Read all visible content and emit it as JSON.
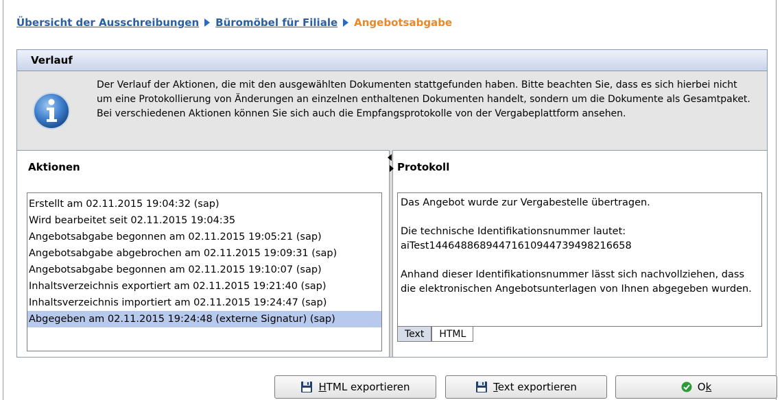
{
  "breadcrumb": {
    "items": [
      "Übersicht der Ausschreibungen",
      "Büromöbel für Filiale"
    ],
    "current": "Angebotsabgabe"
  },
  "panel": {
    "title": "Verlauf",
    "info_text": "Der Verlauf der Aktionen, die mit den ausgewählten Dokumenten stattgefunden haben. Bitte beachten Sie, dass es sich hierbei nicht um eine Protokollierung von Änderungen an einzelnen enthaltenen Dokumenten handelt, sondern um die Dokumente als Gesamtpaket. Bei verschiedenen Aktionen können Sie sich auch die Empfangsprotokolle von der Vergabeplattform ansehen."
  },
  "actions": {
    "title": "Aktionen",
    "items": [
      "Erstellt am 02.11.2015 19:04:32 (sap)",
      "Wird bearbeitet seit 02.11.2015 19:04:35",
      "Angebotsabgabe begonnen am 02.11.2015 19:05:21 (sap)",
      "Angebotsabgabe abgebrochen am 02.11.2015 19:09:31 (sap)",
      "Angebotsabgabe begonnen am 02.11.2015 19:10:07 (sap)",
      "Inhaltsverzeichnis exportiert am 02.11.2015 19:21:40 (sap)",
      "Inhaltsverzeichnis importiert am 02.11.2015 19:24:47 (sap)",
      "Abgegeben am 02.11.2015 19:24:48 (externe Signatur) (sap)"
    ],
    "selected_index": 7
  },
  "protocol": {
    "title": "Protokoll",
    "line1": "Das Angebot wurde zur Vergabestelle übertragen.",
    "line2": "Die technische Identifikationsnummer lautet:",
    "line3": "aiTest1446488689447161094473949821665 8",
    "line4": "Anhand dieser Identifikationsnummer lässt sich nachvollziehen, dass die elektronischen Angebotsunterlagen von Ihnen abgegeben wurden.",
    "tabs": [
      "Text",
      "HTML"
    ],
    "active_tab": "Text"
  },
  "buttons": {
    "html_export_mnemonic": "H",
    "html_export_rest": "TML exportieren",
    "text_export_mnemonic": "T",
    "text_export_rest": "ext exportieren",
    "ok_prefix": "O",
    "ok_mnemonic": "k"
  },
  "colors": {
    "link": "#2b5f9e",
    "current_crumb": "#e8882a",
    "selection": "#b7c9ec",
    "ok_icon": "#2e9b3a"
  },
  "icons": {
    "info": "info-icon",
    "floppy": "floppy-disk-icon",
    "ok": "check-circle-icon",
    "crumb_arrow": "triangle-right-icon"
  }
}
